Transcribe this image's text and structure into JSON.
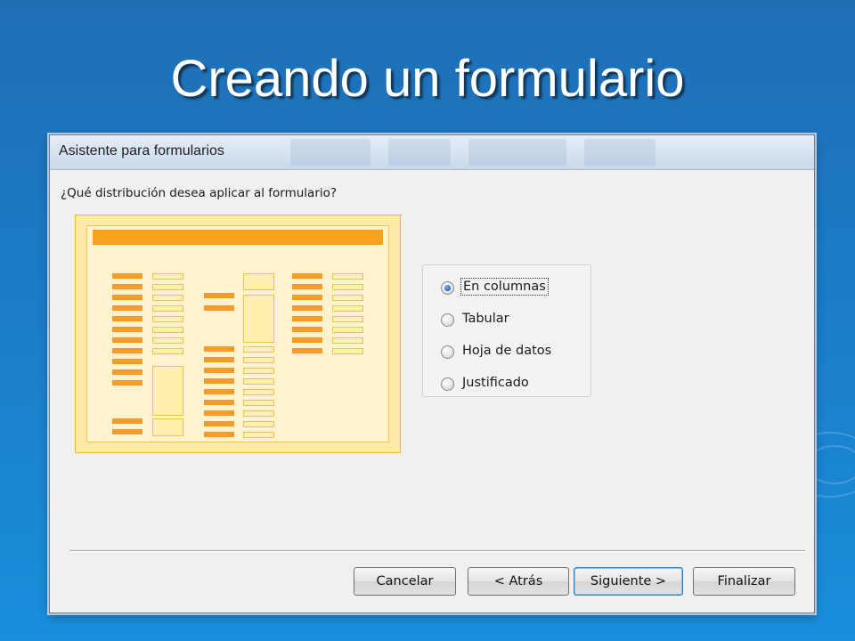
{
  "slide": {
    "title": "Creando un formulario"
  },
  "dialog": {
    "title": "Asistente para formularios",
    "question": "¿Qué distribución desea aplicar al formulario?",
    "preview_icon": "form-layout-preview",
    "options": [
      {
        "label": "En columnas",
        "selected": true
      },
      {
        "label": "Tabular",
        "selected": false
      },
      {
        "label": "Hoja de datos",
        "selected": false
      },
      {
        "label": "Justificado",
        "selected": false
      }
    ],
    "buttons": {
      "cancel": "Cancelar",
      "back": "< Atrás",
      "next": "Siguiente >",
      "finish": "Finalizar"
    }
  },
  "colors": {
    "slide_background": "#1b7bc6",
    "preview_accent": "#f7a21b",
    "radio_selected": "#2a64b8"
  }
}
